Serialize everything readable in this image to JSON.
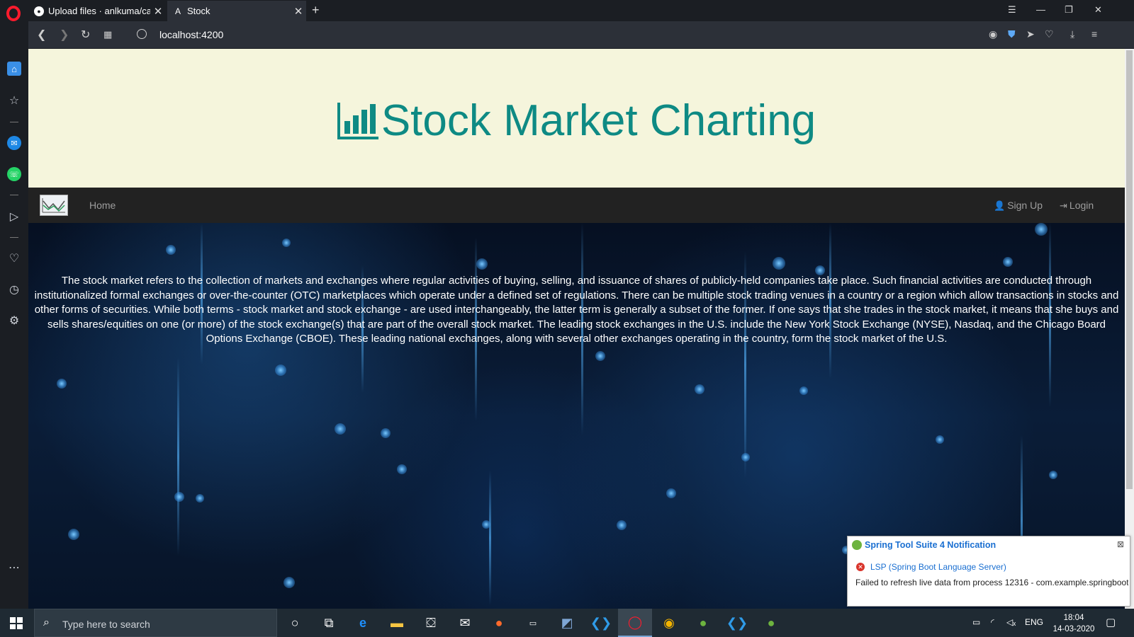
{
  "browser": {
    "tabs": [
      {
        "title": "Upload files · anlkuma/case",
        "favicon": "github-icon"
      },
      {
        "title": "Stock",
        "favicon": "angular-icon"
      }
    ],
    "new_tab_label": "+",
    "url": "localhost:4200"
  },
  "site": {
    "title": "Stock Market Charting",
    "nav": {
      "home": "Home",
      "signup": "Sign Up",
      "login": "Login"
    },
    "about": "The stock market refers to the collection of markets and exchanges where regular activities of buying, selling, and issuance of shares of publicly-held companies take place. Such financial activities are conducted through institutionalized formal exchanges or over-the-counter (OTC) marketplaces which operate under a defined set of regulations. There can be multiple stock trading venues in a country or a region which allow transactions in stocks and other forms of securities. While both terms - stock market and stock exchange - are used interchangeably, the latter term is generally a subset of the former. If one says that she trades in the stock market, it means that she buys and sells shares/equities on one (or more) of the stock exchange(s) that are part of the overall stock market. The leading stock exchanges in the U.S. include the New York Stock Exchange (NYSE), Nasdaq, and the Chicago Board Options Exchange (CBOE). These leading national exchanges, along with several other exchanges operating in the country, form the stock market of the U.S.",
    "accent_color": "#0e8a84",
    "hero_bg": "#f5f5dc"
  },
  "notification": {
    "title": "Spring Tool Suite 4 Notification",
    "source": "LSP (Spring Boot Language Server)",
    "message": "Failed to refresh live data from process 12316 - com.example.springboot"
  },
  "taskbar": {
    "search_placeholder": "Type here to search",
    "language": "ENG",
    "time": "18:04",
    "date": "14-03-2020"
  }
}
